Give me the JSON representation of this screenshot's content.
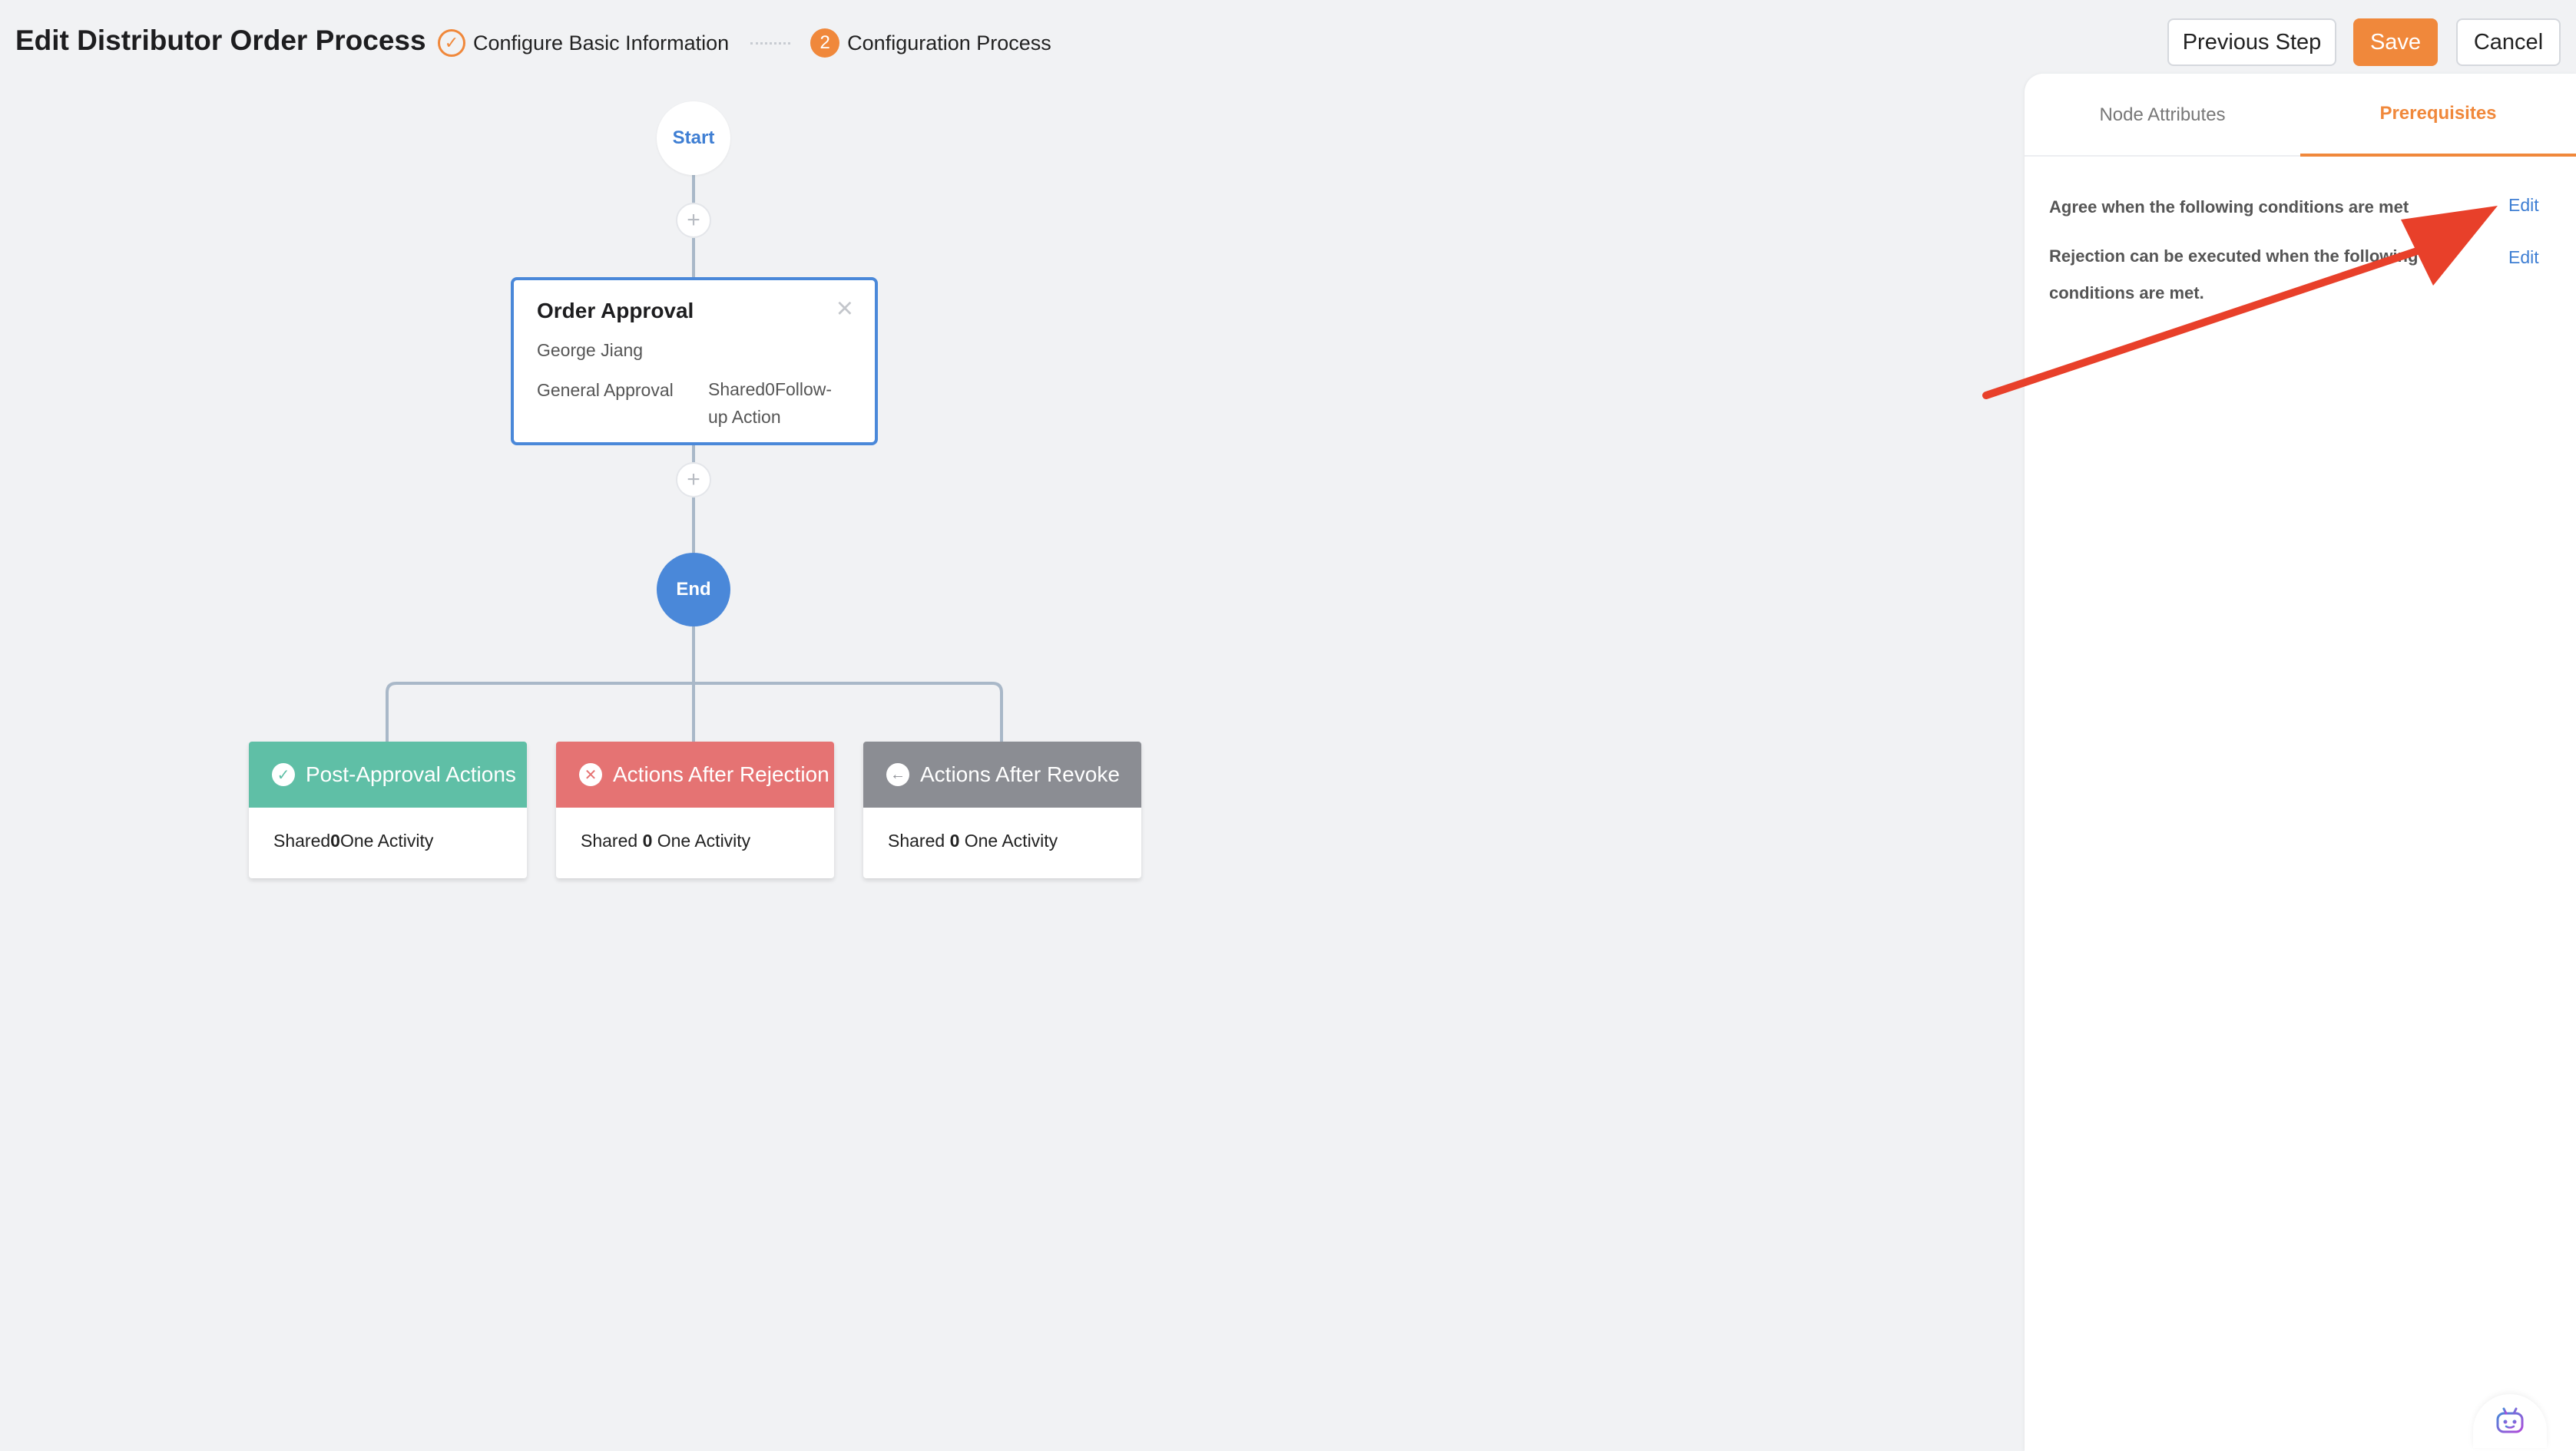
{
  "header": {
    "title": "Edit Distributor Order Process",
    "steps": [
      {
        "label": "Configure Basic Information",
        "status": "done",
        "icon": "check-icon"
      },
      {
        "label": "Configuration Process",
        "status": "current",
        "number": "2"
      }
    ],
    "buttons": {
      "previous": "Previous Step",
      "save": "Save",
      "cancel": "Cancel"
    }
  },
  "flow": {
    "start_label": "Start",
    "end_label": "End",
    "add_symbol": "+",
    "approval_node": {
      "title": "Order Approval",
      "approver": "George Jiang",
      "approval_type": "General Approval",
      "followup": "Shared0Follow-up Action",
      "close_symbol": "×"
    },
    "action_cards": [
      {
        "title": "Post-Approval Actions",
        "icon": "check-circle-icon",
        "color": "#5fbfa6",
        "body_prefix": "Shared",
        "count": "0",
        "body_suffix": "One Activity"
      },
      {
        "title": "Actions After Rejection",
        "icon": "x-circle-icon",
        "color": "#e57373",
        "body_prefix": "Shared ",
        "count": "0",
        "body_suffix": " One Activity"
      },
      {
        "title": "Actions After Revoke",
        "icon": "arrow-left-circle-icon",
        "color": "#8b8d93",
        "body_prefix": "Shared ",
        "count": "0",
        "body_suffix": " One Activity"
      }
    ]
  },
  "panel": {
    "tabs": [
      {
        "label": "Node Attributes",
        "active": false
      },
      {
        "label": "Prerequisites",
        "active": true
      }
    ],
    "conditions": [
      {
        "text": "Agree when the following conditions are met",
        "action": "Edit"
      },
      {
        "text": "Rejection can be executed when the following conditions are met.",
        "action": "Edit"
      }
    ]
  },
  "colors": {
    "accent": "#f0883b",
    "primary_blue": "#4a88d9",
    "link_blue": "#3e7ed3",
    "annotation_red": "#e8402a"
  }
}
